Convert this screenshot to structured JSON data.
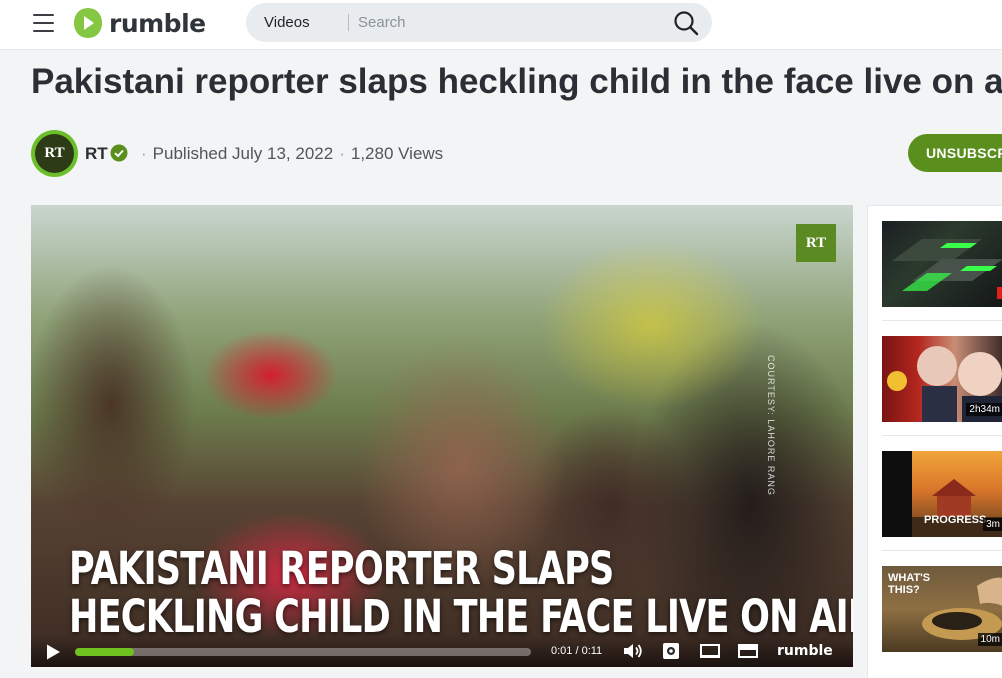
{
  "header": {
    "logo_text": "rumble",
    "search": {
      "category": "Videos",
      "placeholder": "Search"
    }
  },
  "video": {
    "title": "Pakistani reporter slaps heckling child in the face live on air",
    "channel": {
      "name": "RT",
      "avatar_text": "RT",
      "verified": true
    },
    "published": "Published July 13, 2022",
    "views": "1,280 Views",
    "subscribe_button": "UNSUBSCRIBE"
  },
  "player": {
    "badge": "RT",
    "courtesy_text": "COURTESY: LAHORE RANG",
    "caption_line1": "PAKISTANI REPORTER SLAPS",
    "caption_line2": "HECKLING CHILD IN THE FACE LIVE ON AIR",
    "time": "0:01 / 0:11",
    "progress": 0.13,
    "logo_text": "rumble"
  },
  "sidebar": {
    "items": [
      {
        "duration": ""
      },
      {
        "duration": "2h34m"
      },
      {
        "duration": "3m",
        "overlay_text": "PROGRESS"
      },
      {
        "duration": "10m",
        "overlay_text": "WHAT'S THIS?"
      }
    ]
  },
  "colors": {
    "brand_green": "#85c742",
    "unsubscribe_green": "#5a8f1d"
  }
}
